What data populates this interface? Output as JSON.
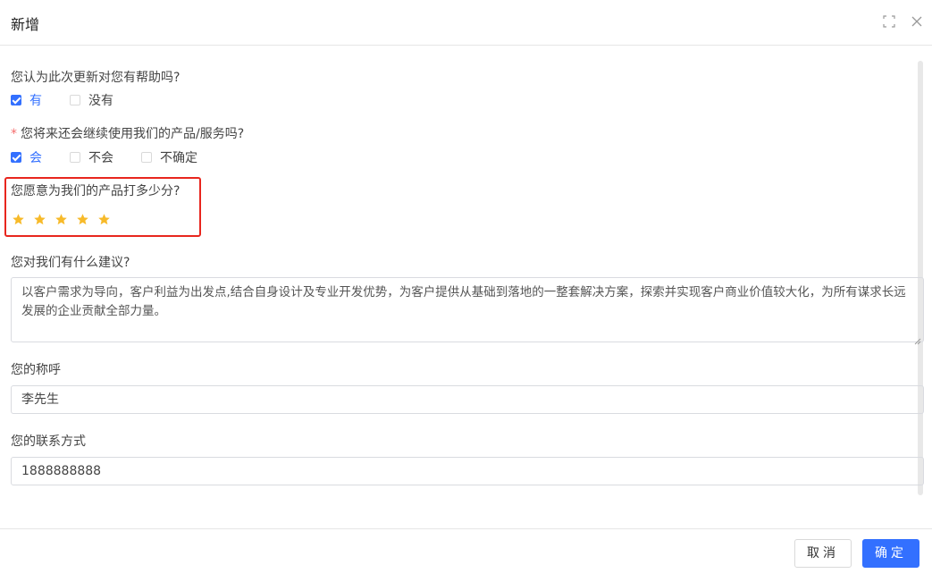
{
  "dialog": {
    "title": "新增",
    "icons": [
      "fullscreen-icon",
      "close-icon"
    ]
  },
  "questions": {
    "q1": {
      "label": "您认为此次更新对您有帮助吗?",
      "options": [
        {
          "label": "有",
          "checked": true
        },
        {
          "label": "没有",
          "checked": false
        }
      ]
    },
    "q2": {
      "required_mark": "*",
      "label": "您将来还会继续使用我们的产品/服务吗?",
      "options": [
        {
          "label": "会",
          "checked": true
        },
        {
          "label": "不会",
          "checked": false
        },
        {
          "label": "不确定",
          "checked": false
        }
      ]
    },
    "q3": {
      "label": "您愿意为我们的产品打多少分?",
      "rating": 5,
      "rating_max": 5
    },
    "q4": {
      "label": "您对我们有什么建议?",
      "value": "以客户需求为导向，客户利益为出发点,结合自身设计及专业开发优势，为客户提供从基础到落地的一整套解决方案，探索并实现客户商业价值较大化，为所有谋求长远发展的企业贡献全部力量。"
    },
    "q5": {
      "label": "您的称呼",
      "value": "李先生"
    },
    "q6": {
      "label": "您的联系方式",
      "value": "1888888888"
    }
  },
  "footer": {
    "cancel_label": "取消",
    "ok_label": "确定"
  },
  "colors": {
    "accent": "#3370ff",
    "star": "#f7ba2a",
    "highlight": "#e8261e",
    "required": "#f56c6c"
  }
}
